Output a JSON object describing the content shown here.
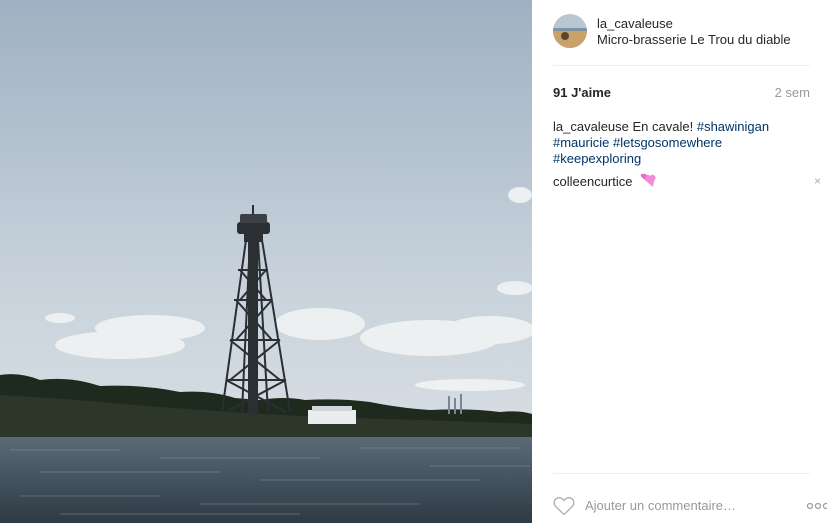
{
  "post": {
    "username": "la_cavaleuse",
    "location": "Micro-brasserie Le Trou du diable",
    "likes_label": "91 J'aime",
    "time_ago": "2 sem"
  },
  "caption": {
    "user": "la_cavaleuse",
    "text": "En cavale!",
    "hashtags": [
      "#shawinigan",
      "#mauricie",
      "#letsgosomewhere",
      "#keepexploring"
    ]
  },
  "comment": {
    "user": "colleencurtice",
    "delete_label": "×"
  },
  "footer": {
    "add_comment_placeholder": "Ajouter un commentaire…"
  },
  "icons": {
    "like": "heart-outline-icon",
    "more": "more-options-icon",
    "comment_emoji": "two-hearts-emoji-icon"
  },
  "colors": {
    "hashtag": "#003569",
    "muted": "#999999"
  }
}
